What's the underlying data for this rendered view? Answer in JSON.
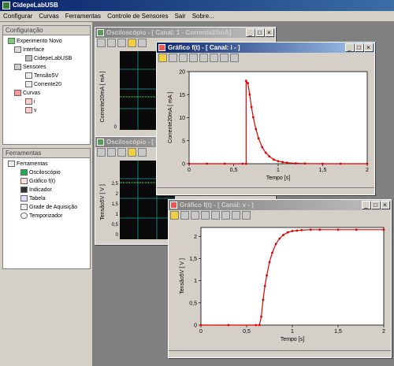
{
  "app": {
    "title": "CidepeLabUSB"
  },
  "menu": [
    "Configurar",
    "Curvas",
    "Ferramentas",
    "Controle de Sensores",
    "Sair",
    "Sobre..."
  ],
  "config": {
    "title": "Configuração",
    "items": [
      "Experimento Novo",
      "Interface",
      "CidepeLabUSB",
      "Sensores",
      "Tensão5V",
      "Corrente20",
      "Curvas",
      "i",
      "v"
    ]
  },
  "tools": {
    "title": "Ferramentas",
    "items": [
      "Ferramentas",
      "Osciloscópio",
      "Gráfico f(t)",
      "Indicador",
      "Tabela",
      "Grade de Aquisição",
      "Temporizador"
    ]
  },
  "osc1": {
    "title": "Osciloscópio - [ Canal: 1 - Corrente20mA]",
    "ylabel": "Corrente20mA [ mA ]",
    "ticks": [
      "0"
    ]
  },
  "osc2": {
    "title": "Osciloscópio - [ Canal: v ]",
    "ylabel": "Tensão5V [ V ]",
    "ticks": [
      "2,5",
      "2",
      "1,5",
      "1",
      "0,5",
      "0"
    ]
  },
  "graph1": {
    "title": "Gráfico f(t) - [ Canal: i - ]"
  },
  "graph2": {
    "title": "Gráfico f(t) - [ Canal: v - ]"
  },
  "chart_data": [
    {
      "type": "scatter",
      "title": "",
      "xlabel": "Tempo [s]",
      "ylabel": "Corrente20mA [ mA ]",
      "xlim": [
        0,
        2
      ],
      "ylim": [
        0,
        20
      ],
      "xticks": [
        "0",
        "0,5",
        "1",
        "1,5",
        "2"
      ],
      "yticks": [
        "0",
        "5",
        "10",
        "15",
        "20"
      ],
      "color": "#e00000",
      "series": [
        {
          "x": [
            0,
            0.2,
            0.4,
            0.6,
            0.64,
            0.64,
            0.66,
            0.68,
            0.7,
            0.72,
            0.75,
            0.78,
            0.82,
            0.86,
            0.9,
            0.95,
            1.0,
            1.05,
            1.1,
            1.2,
            1.3,
            1.5,
            1.7,
            2.0
          ],
          "y": [
            0,
            0,
            0,
            0,
            0,
            18,
            17.5,
            15,
            12.3,
            10.1,
            7.5,
            5.5,
            3.6,
            2.4,
            1.6,
            0.9,
            0.55,
            0.35,
            0.2,
            0.08,
            0.03,
            0,
            0,
            0
          ]
        }
      ]
    },
    {
      "type": "scatter",
      "title": "",
      "xlabel": "Tempo [s]",
      "ylabel": "Tensão5V [ V ]",
      "xlim": [
        0,
        2
      ],
      "ylim": [
        0,
        2.2
      ],
      "xticks": [
        "0",
        "0,5",
        "1",
        "1,5",
        "2"
      ],
      "yticks": [
        "0",
        "0,5",
        "1",
        "1,5",
        "2"
      ],
      "color": "#e00000",
      "series": [
        {
          "x": [
            0,
            0.3,
            0.6,
            0.64,
            0.66,
            0.68,
            0.7,
            0.72,
            0.75,
            0.78,
            0.82,
            0.86,
            0.9,
            0.95,
            1.0,
            1.05,
            1.1,
            1.2,
            1.3,
            1.5,
            1.7,
            2.0
          ],
          "y": [
            0,
            0,
            0,
            0,
            0.19,
            0.57,
            0.88,
            1.12,
            1.42,
            1.63,
            1.83,
            1.95,
            2.03,
            2.09,
            2.12,
            2.13,
            2.14,
            2.15,
            2.15,
            2.15,
            2.15,
            2.15
          ]
        }
      ]
    }
  ]
}
